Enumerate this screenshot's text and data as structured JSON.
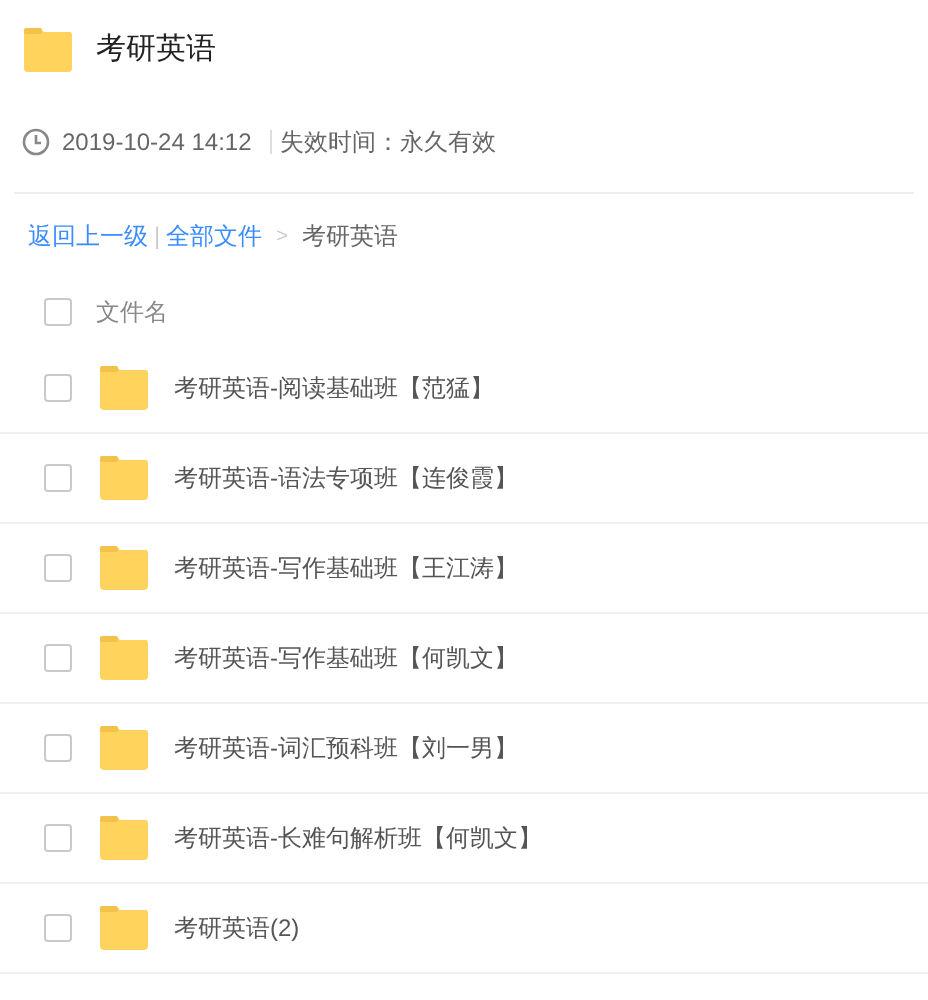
{
  "title": "考研英语",
  "meta": {
    "time": "2019-10-24 14:12",
    "expiry": "失效时间：永久有效"
  },
  "breadcrumb": {
    "back": "返回上一级",
    "separator": "|",
    "root": "全部文件",
    "arrow": ">",
    "current": "考研英语"
  },
  "header": {
    "checked": false,
    "label": "文件名"
  },
  "files": [
    {
      "name": "考研英语-阅读基础班【范猛】",
      "checked": false
    },
    {
      "name": "考研英语-语法专项班【连俊霞】",
      "checked": false
    },
    {
      "name": "考研英语-写作基础班【王江涛】",
      "checked": false
    },
    {
      "name": "考研英语-写作基础班【何凯文】",
      "checked": false
    },
    {
      "name": "考研英语-词汇预科班【刘一男】",
      "checked": false
    },
    {
      "name": "考研英语-长难句解析班【何凯文】",
      "checked": false
    },
    {
      "name": "考研英语(2)",
      "checked": false
    }
  ]
}
